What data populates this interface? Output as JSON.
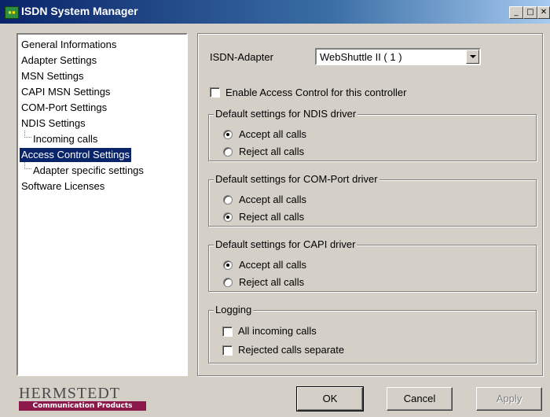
{
  "window": {
    "title": "ISDN System Manager",
    "app_icon_text": "",
    "controls": {
      "minimize": "_",
      "maximize": "□",
      "close": "✕"
    }
  },
  "tree": {
    "items": [
      {
        "label": "General Informations"
      },
      {
        "label": "Adapter Settings"
      },
      {
        "label": "MSN Settings"
      },
      {
        "label": "CAPI MSN Settings"
      },
      {
        "label": "COM-Port Settings"
      },
      {
        "label": "NDIS Settings"
      },
      {
        "label": "Incoming calls"
      },
      {
        "label": "Access Control Settings",
        "selected": true
      },
      {
        "label": "Adapter specific settings"
      },
      {
        "label": "Software Licenses"
      }
    ]
  },
  "settings": {
    "adapter_label": "ISDN-Adapter",
    "adapter_value": "WebShuttle II  ( 1 )",
    "enable_access_control": {
      "label": "Enable Access Control for this controller",
      "checked": false
    },
    "groups": [
      {
        "title": "Default settings for NDIS driver",
        "options": [
          "Accept all calls",
          "Reject all calls"
        ],
        "selected": 0
      },
      {
        "title": "Default settings for COM-Port driver",
        "options": [
          "Accept all calls",
          "Reject all calls"
        ],
        "selected": 1
      },
      {
        "title": "Default settings for CAPI driver",
        "options": [
          "Accept all calls",
          "Reject all calls"
        ],
        "selected": 0
      }
    ],
    "logging": {
      "title": "Logging",
      "options": [
        {
          "label": "All incoming calls",
          "checked": false
        },
        {
          "label": "Rejected calls separate",
          "checked": false
        }
      ]
    }
  },
  "buttons": {
    "ok": "OK",
    "cancel": "Cancel",
    "apply": "Apply"
  },
  "logo": {
    "name": "HERMSTEDT",
    "tagline": "Communication Products"
  },
  "colors": {
    "titlebar": "#0a246a",
    "selection": "#0a246a",
    "face": "#d4d0c8",
    "logo_bar": "#8b1a4a"
  }
}
